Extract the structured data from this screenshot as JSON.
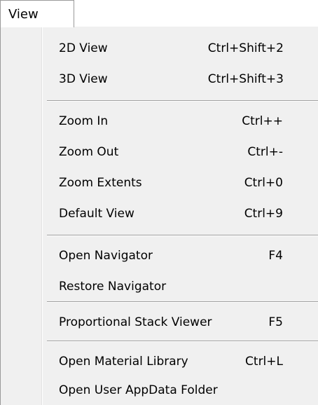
{
  "menubar": {
    "active_menu": "View"
  },
  "menu": {
    "groups": [
      {
        "items": [
          {
            "label": "2D View",
            "shortcut": "Ctrl+Shift+2"
          },
          {
            "label": "3D View",
            "shortcut": "Ctrl+Shift+3"
          }
        ]
      },
      {
        "items": [
          {
            "label": "Zoom In",
            "shortcut": "Ctrl++"
          },
          {
            "label": "Zoom Out",
            "shortcut": "Ctrl+-"
          },
          {
            "label": "Zoom Extents",
            "shortcut": "Ctrl+0"
          },
          {
            "label": "Default View",
            "shortcut": "Ctrl+9"
          }
        ]
      },
      {
        "items": [
          {
            "label": "Open Navigator",
            "shortcut": "F4"
          },
          {
            "label": "Restore Navigator",
            "shortcut": ""
          }
        ]
      },
      {
        "items": [
          {
            "label": "Proportional Stack Viewer",
            "shortcut": "F5"
          }
        ]
      },
      {
        "items": [
          {
            "label": "Open Material Library",
            "shortcut": "Ctrl+L"
          },
          {
            "label": "Open User AppData Folder",
            "shortcut": ""
          }
        ]
      }
    ]
  }
}
